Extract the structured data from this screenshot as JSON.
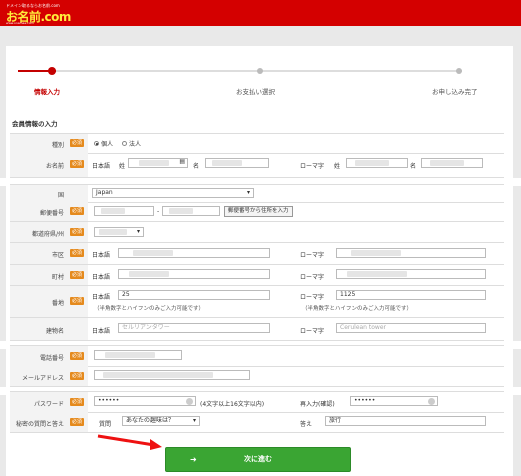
{
  "header": {
    "logo_tagline": "ドメイン取るならお名前.com",
    "logo_text": "お名前.com",
    "logo_url": "www.onamae.com"
  },
  "steps": [
    {
      "label": "情報入力",
      "active": true
    },
    {
      "label": "お支払い選択",
      "active": false
    },
    {
      "label": "お申し込み完了",
      "active": false
    }
  ],
  "section_title": "会員情報の入力",
  "required_badge": "必須",
  "form": {
    "type": {
      "label": "種別",
      "options": [
        "個人",
        "法人"
      ],
      "selected": "個人"
    },
    "name": {
      "label": "お名前",
      "jp_label": "日本語",
      "last_label": "姓",
      "first_label": "名",
      "roman_label": "ローマ字",
      "roman_last_label": "姓",
      "roman_first_label": "名"
    },
    "country": {
      "label": "国",
      "value": "Japan"
    },
    "postal": {
      "label": "郵便番号",
      "lookup_button": "郵便番号から住所を入力"
    },
    "prefecture": {
      "label": "都道府県/州"
    },
    "city": {
      "label": "市区",
      "jp_label": "日本語",
      "roman_label": "ローマ字"
    },
    "town": {
      "label": "町村",
      "jp_label": "日本語",
      "roman_label": "ローマ字"
    },
    "address_number": {
      "label": "番地",
      "jp_label": "日本語",
      "jp_value": "25",
      "roman_label": "ローマ字",
      "roman_value": "1125",
      "jp_note": "（半角数字とハイフンのみご入力可能です）",
      "roman_note": "（半角数字とハイフンのみご入力可能です）"
    },
    "building": {
      "label": "建物名",
      "jp_label": "日本語",
      "jp_placeholder": "セルリアンタワー",
      "roman_label": "ローマ字",
      "roman_placeholder": "Cerulean tower"
    },
    "phone": {
      "label": "電話番号"
    },
    "email": {
      "label": "メールアドレス"
    },
    "password": {
      "label": "パスワード",
      "value": "••••••",
      "hint": "(4文字以上16文字以内)",
      "confirm_label": "再入力(確認)",
      "confirm_value": "••••••"
    },
    "secret": {
      "label": "秘密の質問と答え",
      "question_label": "質問",
      "question_value": "あなたの趣味は？",
      "answer_label": "答え",
      "answer_value": "旅行"
    }
  },
  "next_button": {
    "arrow": "➜",
    "label": "次に進む"
  },
  "colors": {
    "brand_red": "#d40000",
    "step_active": "#c40000",
    "required_orange": "#e58a1d",
    "next_green": "#3aa533"
  }
}
